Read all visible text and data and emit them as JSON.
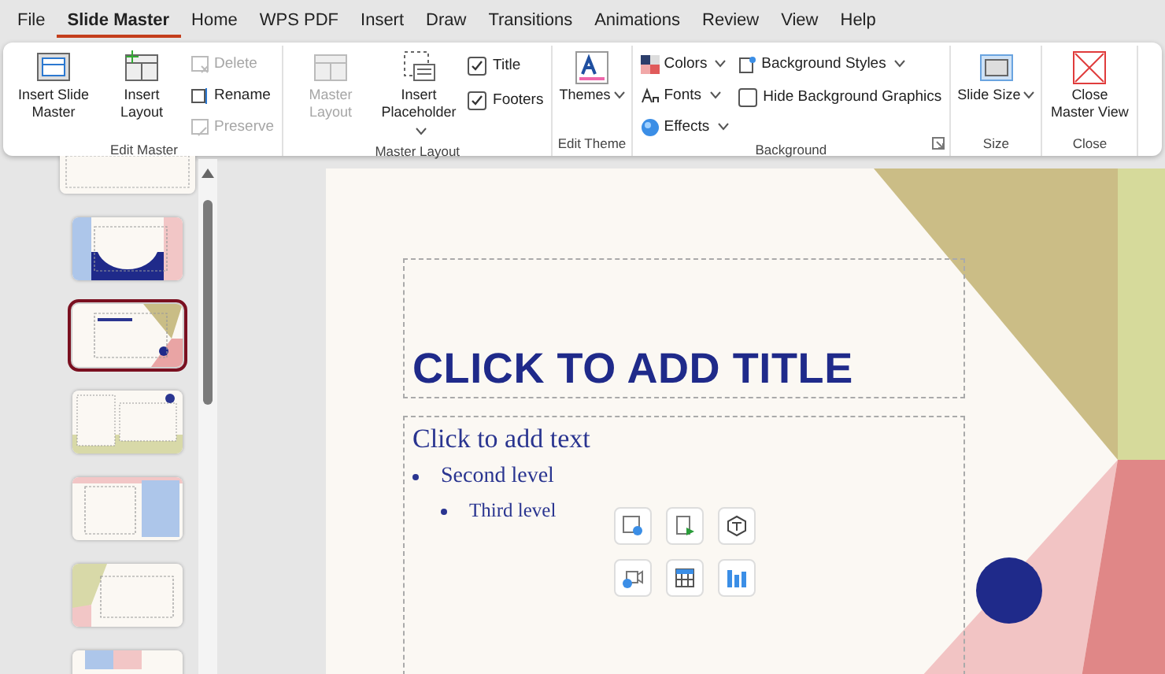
{
  "menu_tabs": [
    {
      "label": "File",
      "selected": false
    },
    {
      "label": "Slide Master",
      "selected": true
    },
    {
      "label": "Home",
      "selected": false
    },
    {
      "label": "WPS PDF",
      "selected": false
    },
    {
      "label": "Insert",
      "selected": false
    },
    {
      "label": "Draw",
      "selected": false
    },
    {
      "label": "Transitions",
      "selected": false
    },
    {
      "label": "Animations",
      "selected": false
    },
    {
      "label": "Review",
      "selected": false
    },
    {
      "label": "View",
      "selected": false
    },
    {
      "label": "Help",
      "selected": false
    }
  ],
  "ribbon": {
    "groups": [
      {
        "label": "Edit Master",
        "large": [
          {
            "label": "Insert Slide Master",
            "disabled": false
          },
          {
            "label": "Insert Layout",
            "disabled": false
          }
        ],
        "small": [
          {
            "kind": "button",
            "label": "Delete",
            "disabled": true
          },
          {
            "kind": "button",
            "label": "Rename",
            "disabled": false
          },
          {
            "kind": "button",
            "label": "Preserve",
            "disabled": true
          }
        ]
      },
      {
        "label": "Master Layout",
        "large": [
          {
            "label": "Master Layout",
            "disabled": true
          },
          {
            "label": "Insert Placeholder",
            "disabled": false,
            "dropdown": true
          }
        ],
        "small": [
          {
            "kind": "checkbox",
            "label": "Title",
            "checked": true
          },
          {
            "kind": "checkbox",
            "label": "Footers",
            "checked": true
          }
        ]
      },
      {
        "label": "Edit Theme",
        "large": [
          {
            "label": "Themes",
            "disabled": false,
            "dropdown": true
          }
        ]
      },
      {
        "label": "Background",
        "small": [
          {
            "kind": "menu",
            "label": "Colors"
          },
          {
            "kind": "menu",
            "label": "Fonts"
          },
          {
            "kind": "menu",
            "label": "Effects"
          },
          {
            "kind": "menu",
            "label": "Background Styles"
          },
          {
            "kind": "checkbox",
            "label": "Hide Background Graphics",
            "checked": false
          }
        ],
        "launcher": true
      },
      {
        "label": "Size",
        "large": [
          {
            "label": "Slide Size",
            "disabled": false,
            "dropdown": true
          }
        ]
      },
      {
        "label": "Close",
        "large": [
          {
            "label": "Close Master View",
            "disabled": false
          }
        ]
      }
    ]
  },
  "thumbnails": [
    {
      "kind": "cut-off",
      "selected": false
    },
    {
      "kind": "arch",
      "selected": false
    },
    {
      "kind": "content",
      "selected": true
    },
    {
      "kind": "two-column",
      "selected": false
    },
    {
      "kind": "picture",
      "selected": false
    },
    {
      "kind": "olive",
      "selected": false
    },
    {
      "kind": "blank",
      "selected": false
    }
  ],
  "slide": {
    "title": "CLICK TO ADD TITLE",
    "body": [
      {
        "text": "Click to add text",
        "children": [
          {
            "text": "Second level",
            "children": [
              {
                "text": "Third level"
              }
            ]
          }
        ]
      }
    ],
    "insert_buttons": [
      {
        "kind": "picture"
      },
      {
        "kind": "document"
      },
      {
        "kind": "cube"
      },
      {
        "kind": "video"
      },
      {
        "kind": "table"
      },
      {
        "kind": "chart"
      }
    ]
  }
}
